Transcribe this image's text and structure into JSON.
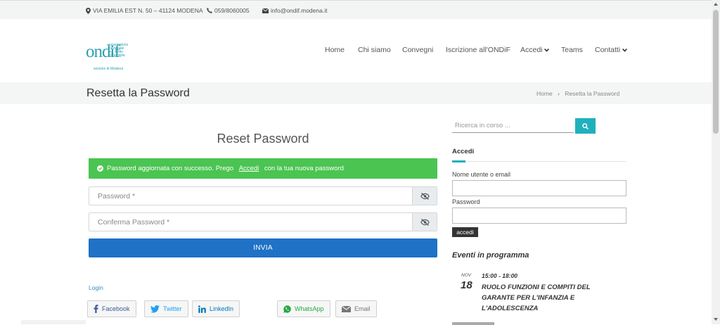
{
  "topbar": {
    "address": "VIA EMILIA EST N. 50 – 41124 MODENA",
    "phone": "059/8060005",
    "email": "info@ondif.modena.it"
  },
  "logo": {
    "letters": "ondif",
    "line1": "osservatorio",
    "line2": "nazionale",
    "line3": "sul diritto",
    "line4": "di famiglia",
    "section": "sezione di Modena"
  },
  "nav": {
    "home": "Home",
    "chi_siamo": "Chi siamo",
    "convegni": "Convegni",
    "iscrizione": "Iscrizione all'ONDiF",
    "accedi": "Accedi",
    "teams": "Teams",
    "contatti": "Contatti"
  },
  "titlebar": {
    "title": "Resetta la Password",
    "crumb_home": "Home",
    "crumb_sep": "›",
    "crumb_current": "Resetta la Password"
  },
  "form": {
    "heading": "Reset Password",
    "alert_pre": "Password aggiornata con successo. Prego ",
    "alert_link": "Accedi",
    "alert_post": " con la tua nuova password",
    "password_placeholder": "Password *",
    "confirm_placeholder": "Conferma Password *",
    "submit_label": "INVIA",
    "login_link": "Login"
  },
  "share": {
    "facebook": "Facebook",
    "twitter": "Twitter",
    "linkedin": "LinkedIn",
    "whatsapp": "WhatsApp",
    "email": "Email"
  },
  "sidebar": {
    "search_placeholder": "Ricerca in corso ...",
    "widget_title": "Accedi",
    "username_label": "Nome utente o email",
    "password_label": "Password",
    "login_button": "accedi",
    "events_title": "Eventi in programma",
    "event": {
      "month": "NOV",
      "day": "18",
      "time": "15:00 - 18:00",
      "title": "RUOLO FUNZIONI E COMPITI DEL GARANTE PER L'INFANZIA E L'ADOLESCENZA"
    }
  },
  "colors": {
    "accent": "#20b0bd",
    "success": "#4bc452",
    "primary": "#1f72c5",
    "logo": "#2c9fb0"
  }
}
